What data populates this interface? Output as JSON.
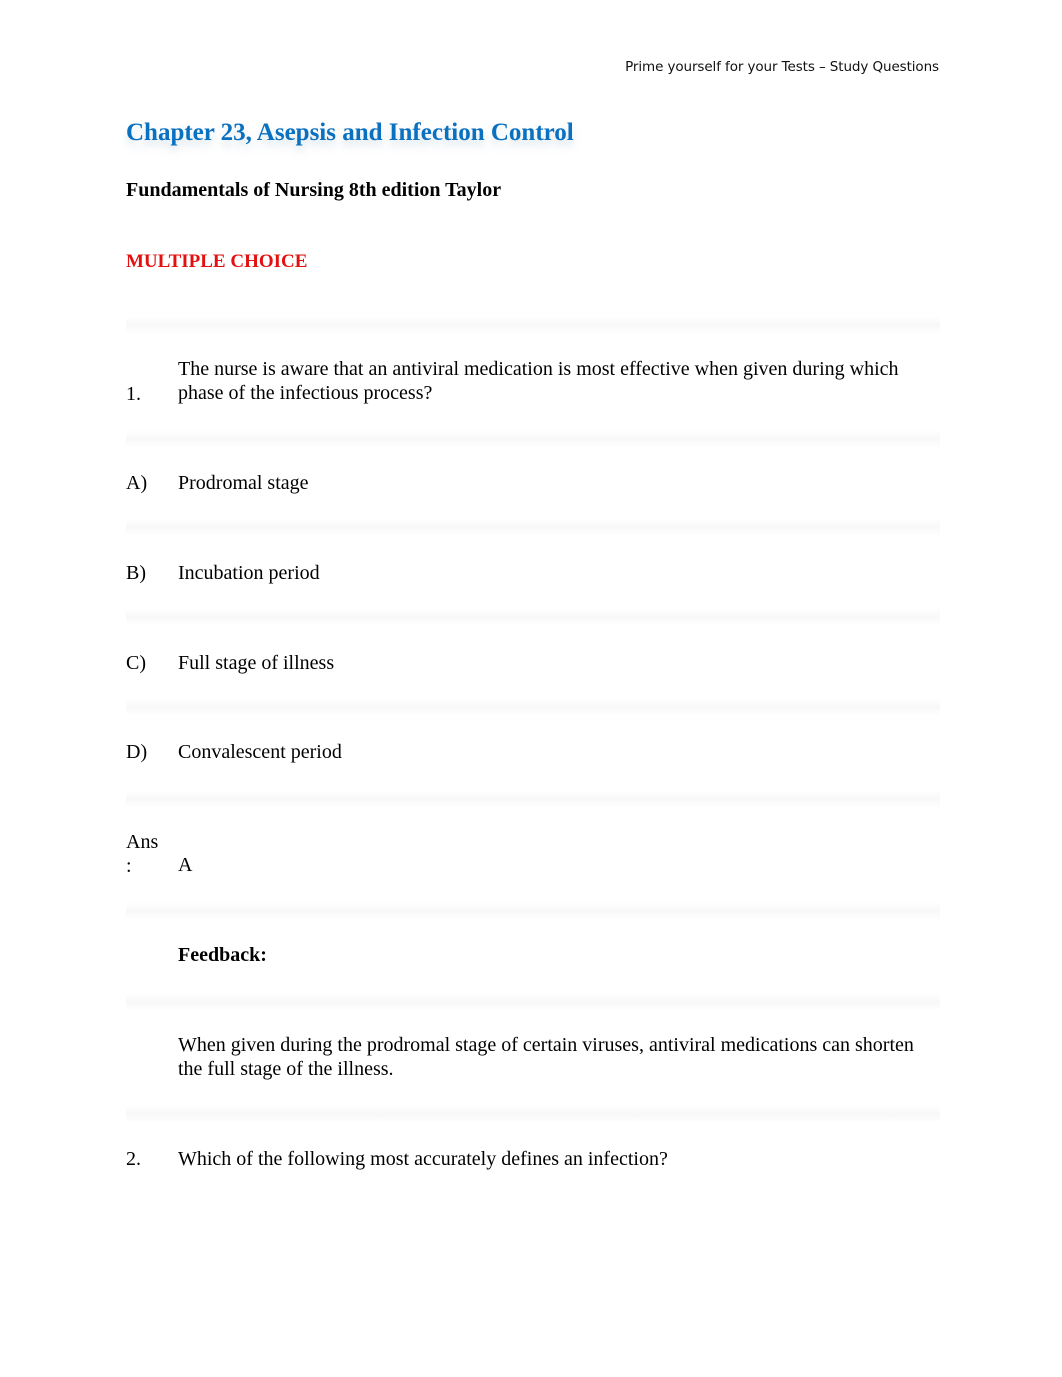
{
  "header_note": "Prime yourself for your Tests – Study Questions",
  "title": "Chapter 23, Asepsis and Infection Control",
  "subtitle": "Fundamentals of Nursing 8th edition Taylor",
  "section": "MULTIPLE CHOICE",
  "question1": {
    "number": "1.",
    "text": "The nurse is aware that an antiviral medication is most effective when given during which phase of the infectious process?",
    "options": [
      {
        "label": "A)",
        "text": "Prodromal stage"
      },
      {
        "label": "B)",
        "text": "Incubation period"
      },
      {
        "label": "C)",
        "text": "Full stage of illness"
      },
      {
        "label": "D)",
        "text": "Convalescent period"
      }
    ],
    "answer_label_line1": "Ans",
    "answer_label_line2": ":",
    "answer": "A",
    "feedback_label": "Feedback:",
    "feedback": "When given during the prodromal stage of certain viruses, antiviral medications can shorten the full stage of the illness."
  },
  "question2": {
    "number": "2.",
    "text": "Which of the following most accurately defines an infection?"
  }
}
